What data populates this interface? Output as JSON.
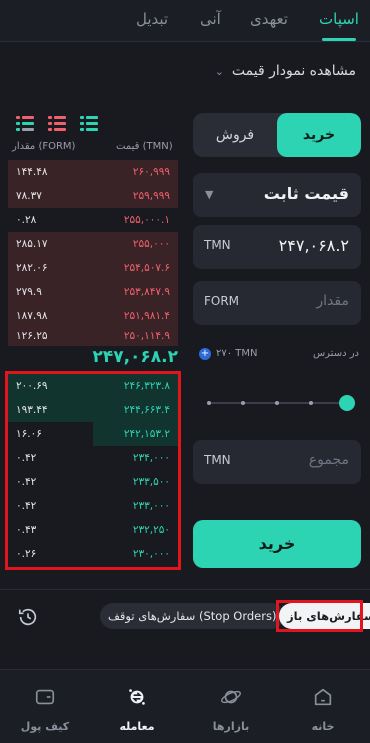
{
  "top_tabs": [
    {
      "label": "اسپات",
      "active": true
    },
    {
      "label": "تعهدی",
      "active": false
    },
    {
      "label": "آنی",
      "active": false
    },
    {
      "label": "تبدیل",
      "active": false
    }
  ],
  "chart_link": "مشاهده نمودار قیمت",
  "order_book": {
    "header_price": "قیمت (TMN)",
    "header_qty": "مقدار (FORM)",
    "sells": [
      {
        "price": "۲۶۰,۹۹۹",
        "qty": "۱۴۴.۴۸"
      },
      {
        "price": "۲۵۹,۹۹۹",
        "qty": "۷۸.۳۷"
      },
      {
        "price": "۲۵۵,۰۰۰.۱",
        "qty": "۰.۲۸"
      },
      {
        "price": "۲۵۵,۰۰۰",
        "qty": "۲۸۵.۱۷"
      },
      {
        "price": "۲۵۴,۵۰۷.۶",
        "qty": "۲۸۲.۰۶"
      },
      {
        "price": "۲۵۳,۸۴۷.۹",
        "qty": "۲۷۹.۹"
      },
      {
        "price": "۲۵۱,۹۸۱.۴",
        "qty": "۱۸۷.۹۸"
      },
      {
        "price": "۲۵۰,۱۱۴.۹",
        "qty": "۱۲۶.۲۵"
      }
    ],
    "last_price": "۲۴۷,۰۶۸.۲",
    "buys": [
      {
        "price": "۲۴۶,۳۲۳.۸",
        "qty": "۲۰۰.۶۹"
      },
      {
        "price": "۲۴۴,۶۶۳.۴",
        "qty": "۱۹۳.۴۴"
      },
      {
        "price": "۲۴۲,۱۵۳.۲",
        "qty": "۱۶.۰۶"
      },
      {
        "price": "۲۳۴,۰۰۰",
        "qty": "۰.۴۲"
      },
      {
        "price": "۲۳۳,۵۰۰",
        "qty": "۰.۴۲"
      },
      {
        "price": "۲۳۳,۰۰۰",
        "qty": "۰.۴۲"
      },
      {
        "price": "۲۳۲,۲۵۰",
        "qty": "۰.۴۳"
      },
      {
        "price": "۲۳۰,۰۰۰",
        "qty": "۰.۲۶"
      }
    ]
  },
  "form": {
    "buy_tab": "خرید",
    "sell_tab": "فروش",
    "order_type": "قیمت ثابت",
    "price_value": "۲۴۷,۰۶۸.۲",
    "price_unit": "TMN",
    "amount_placeholder": "مقدار",
    "amount_unit": "FORM",
    "available_label": "در دسترس",
    "available_value": "۲۷۰ TMN",
    "total_placeholder": "مجموع",
    "total_unit": "TMN",
    "submit": "خرید"
  },
  "orders": {
    "open_orders": "سفارش‌های باز",
    "stop_orders": "سفارش‌های توقف (Stop Orders)"
  },
  "bottom_nav": [
    {
      "label": "خانه",
      "icon": "home-icon",
      "active": false
    },
    {
      "label": "بازارها",
      "icon": "planet-icon",
      "active": false
    },
    {
      "label": "معامله",
      "icon": "trade-icon",
      "active": true
    },
    {
      "label": "کیف پول",
      "icon": "wallet-icon",
      "active": false
    }
  ],
  "colors": {
    "accent": "#2dd4b4",
    "sell": "#f0616d",
    "highlight": "#e0151d"
  }
}
